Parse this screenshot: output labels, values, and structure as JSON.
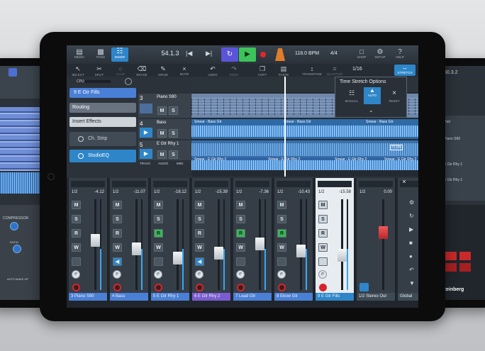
{
  "transport": {
    "position": "54.1.3",
    "tempo": "118.0 BPM",
    "signature": "4/4"
  },
  "toolbar": {
    "media": "MEDIA",
    "pads": "PADS",
    "mixer": "MIXER",
    "shop": "SHOP",
    "setup": "SETUP",
    "help": "HELP"
  },
  "tools": {
    "select": "SELECT",
    "split": "SPLIT",
    "glue": "GLUE",
    "erase": "ERASE",
    "draw": "DRAW",
    "mute": "MUTE",
    "undo": "UNDO",
    "redo": "REDO",
    "copy": "COPY",
    "paste": "PASTE",
    "transpose": "TRANSPOSE",
    "quantize": "QUANTIZE",
    "stretch": "STRETCH",
    "zoom": "1/16"
  },
  "inspector": {
    "cpu": "CPU",
    "track": "9  E Gtr Fills",
    "routing": "Routing",
    "insert": "Insert Effects",
    "chstrip": "Ch. Strip",
    "eq": "StudioEQ"
  },
  "tracks": [
    {
      "num": "3",
      "name": "Piano S90"
    },
    {
      "num": "4",
      "name": "Bass"
    },
    {
      "num": "5",
      "name": "E Gtr Rhy 1"
    }
  ],
  "track_footer": {
    "track": "TRACK",
    "audio": "AUDIO",
    "midi": "MIDI"
  },
  "events": {
    "bass1": "Smear - Bass Gtr",
    "bass2": "Smear - Bass Gtr",
    "bass3": "Smear - Bass Gtr",
    "gtr1": "Smear - E Gtr Rhy 2",
    "gtr2": "Smear - E Gtr Rhy 2",
    "gtr3": "Smear - E Gtr Rhy 2",
    "gtr4": "Smear - E Gtr Rhy 2",
    "pct": "72.9%"
  },
  "time_stretch": {
    "title": "Time Stretch Options",
    "manual": "MANUAL",
    "auto": "AUTO",
    "reset": "RESET"
  },
  "channels": [
    {
      "route": "1/2",
      "vol": "-4.12",
      "name": "3  Piano S90",
      "color": "#4a7fd6"
    },
    {
      "route": "1/2",
      "vol": "-11.07",
      "name": "4  Bass",
      "color": "#4a7fd6"
    },
    {
      "route": "1/2",
      "vol": "-18.12",
      "name": "5  E Gtr Rhy 1",
      "color": "#4a7fd6"
    },
    {
      "route": "1/2",
      "vol": "-15.39",
      "name": "6  E Gtr Rhy 2",
      "color": "#7a5bd0"
    },
    {
      "route": "1/2",
      "vol": "-7.36",
      "name": "7  Lead Gtr",
      "color": "#4a7fd6"
    },
    {
      "route": "1/2",
      "vol": "-10.43",
      "name": "8  Ebow Gtr",
      "color": "#4a7fd6"
    },
    {
      "route": "1/2",
      "vol": "-15.58",
      "name": "9  E Gtr Fills",
      "color": "#4a7fd6"
    },
    {
      "route": "1/2",
      "vol": "0.00",
      "name": "1/2  Stereo Out",
      "color": "#3e4a55"
    },
    {
      "route": "",
      "vol": "",
      "name": "Global",
      "color": "#3e4a55"
    }
  ],
  "strip": {
    "m": "M",
    "s": "S",
    "r": "R",
    "w": "W",
    "e": "e"
  },
  "left_tablet": {
    "compressor": "COMPRESSOR",
    "ratio": "RATIO",
    "auto": "AUTO",
    "makeup": "MAKE UP"
  },
  "right_tablet": {
    "position": "60.3.2",
    "t1": "Pad",
    "t2": "Piano S90",
    "t3": "E Gtr Rhy 1",
    "t4": "E Gtr Rhy 1",
    "brand": "Steinberg"
  }
}
